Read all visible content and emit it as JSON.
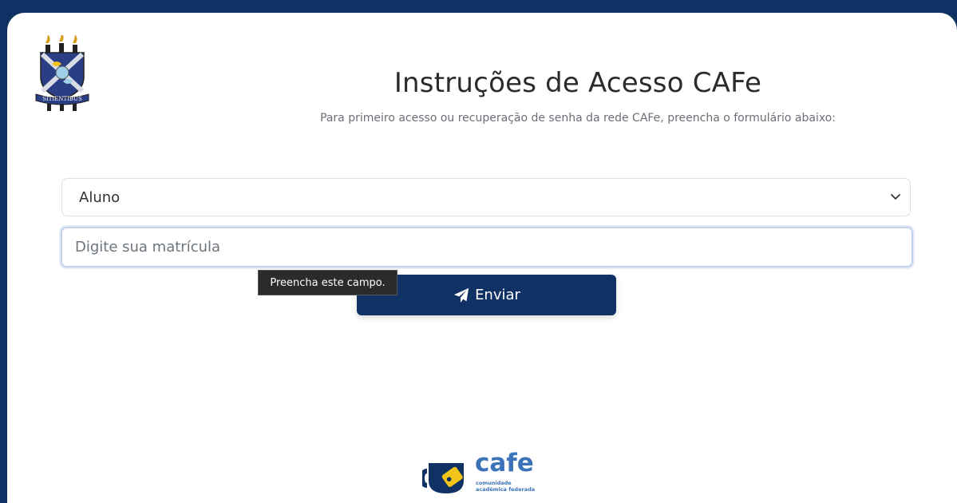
{
  "header": {
    "title": "Instruções de Acesso CAFe",
    "subtitle": "Para primeiro acesso ou recuperação de senha da rede CAFe, preencha o formulário abaixo:",
    "crest_motto": "SITIENTIBUS"
  },
  "form": {
    "user_type": {
      "selected": "Aluno"
    },
    "registration": {
      "value": "",
      "placeholder": "Digite sua matrícula"
    },
    "validation_tooltip": "Preencha este campo.",
    "submit_label": "Enviar"
  },
  "footer": {
    "logo_word": "cafe",
    "logo_line1": "comunidade",
    "logo_line2": "acadêmica federada"
  },
  "colors": {
    "brand_dark": "#0f3163",
    "cafe_blue": "#3b72b8",
    "cafe_yellow": "#f2c318"
  },
  "icons": {
    "crest": "university-crest-icon",
    "select_arrow": "chevron-down-icon",
    "send": "paper-plane-icon",
    "logo_cup": "cafe-cup-icon"
  }
}
